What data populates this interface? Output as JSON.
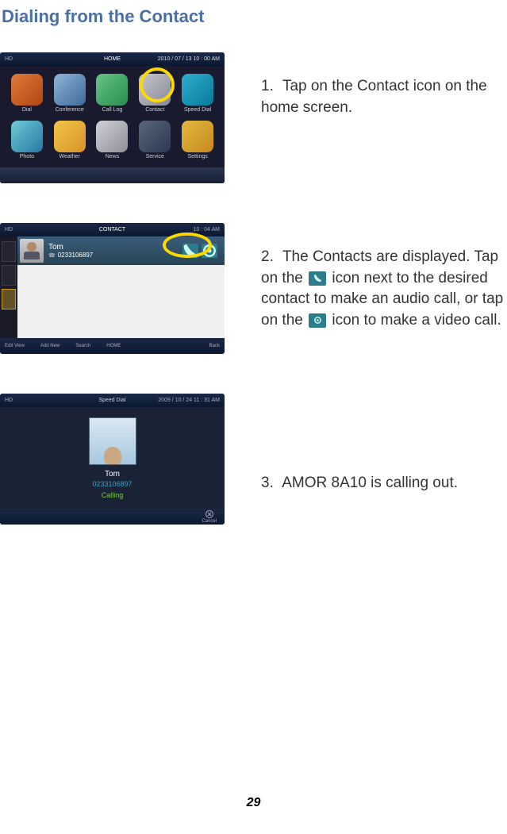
{
  "title": "Dialing from the Contact",
  "pageNumber": "29",
  "steps": {
    "s1": {
      "num": "1.",
      "text": "Tap on the Contact icon on the home screen."
    },
    "s2": {
      "num": "2.",
      "part1": "The Contacts are displayed. Tap on the ",
      "part2": " icon next to the desired contact to make an audio call, or tap on the ",
      "part3": "icon to make a video call."
    },
    "s3": {
      "num": "3.",
      "text": "AMOR 8A10 is calling out."
    }
  },
  "ss1": {
    "header": {
      "left": "HD",
      "center": "HOME",
      "right": "2010 / 07 / 13  10 : 00 AM"
    },
    "tiles": [
      {
        "label": "Dial",
        "color": "linear-gradient(135deg,#e07a3a,#b04512)"
      },
      {
        "label": "Conference",
        "color": "linear-gradient(135deg,#8fb4d8,#3d6b9a)"
      },
      {
        "label": "Call Log",
        "color": "linear-gradient(135deg,#66c488,#2a8c50)"
      },
      {
        "label": "Contact",
        "color": "linear-gradient(135deg,#c8c8d0,#888898)"
      },
      {
        "label": "Speed Dial",
        "color": "linear-gradient(135deg,#2daed0,#0a7a98)"
      },
      {
        "label": "Photo",
        "color": "linear-gradient(135deg,#6fcad5,#2878a4)"
      },
      {
        "label": "Weather",
        "color": "linear-gradient(135deg,#f3c648,#d8912a)"
      },
      {
        "label": "News",
        "color": "linear-gradient(135deg,#d0d0d6,#8f8f98)"
      },
      {
        "label": "Service",
        "color": "linear-gradient(135deg,#5a667a,#2a3a52)"
      },
      {
        "label": "Settings",
        "color": "linear-gradient(135deg,#e0b840,#c88a20)"
      }
    ]
  },
  "ss2": {
    "header": {
      "center": "CONTACT",
      "right": "10 : 04 AM"
    },
    "contact": {
      "name": "Tom",
      "number": "0233106897"
    },
    "bottom": [
      "Edit View",
      "Add New",
      "Search",
      "HOME",
      "Back"
    ]
  },
  "ss3": {
    "header": {
      "center": "Speed Dial",
      "right": "2009 / 10 / 24    11 : 31 AM"
    },
    "name": "Tom",
    "number": "0233106897",
    "status": "Calling",
    "cancel": "Cancel"
  }
}
